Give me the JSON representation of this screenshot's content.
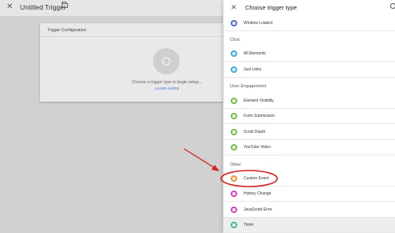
{
  "left": {
    "title": "Untitled Trigger",
    "card": {
      "title": "Trigger Configuration",
      "prompt": "Choose a trigger type to begin setup...",
      "learn_more": "LEARN MORE"
    }
  },
  "panel": {
    "title": "Choose trigger type",
    "rows": {
      "window_loaded": {
        "label": "Window Loaded",
        "color": "#4a68d6"
      },
      "all_elements": {
        "label": "All Elements",
        "color": "#39a9dc"
      },
      "just_links": {
        "label": "Just Links",
        "color": "#39a9dc"
      },
      "element_visibility": {
        "label": "Element Visibility",
        "color": "#6cbf4a"
      },
      "form_submission": {
        "label": "Form Submission",
        "color": "#6cbf4a"
      },
      "scroll_depth": {
        "label": "Scroll Depth",
        "color": "#6cbf4a"
      },
      "youtube_video": {
        "label": "YouTube Video",
        "color": "#6cbf4a"
      },
      "custom_event": {
        "label": "Custom Event",
        "color": "#f2912a"
      },
      "history_change": {
        "label": "History Change",
        "color": "#d63cc4"
      },
      "javascript_error": {
        "label": "JavaScript Error",
        "color": "#d63cc4"
      },
      "timer": {
        "label": "Timer",
        "color": "#3cb39a"
      }
    },
    "sections": {
      "click": "Click",
      "user_engagement": "User Engagement",
      "other": "Other"
    }
  },
  "annotation": {
    "color": "#d42020",
    "highlighted_item": "Custom Event"
  }
}
